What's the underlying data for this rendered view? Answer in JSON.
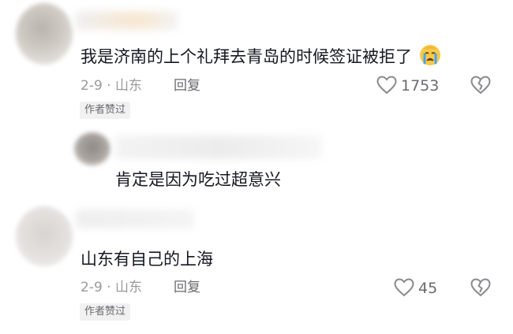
{
  "colors": {
    "text_primary": "#161823",
    "text_meta": "#9a9a9e",
    "badge_bg": "#f1f1f2",
    "icon_stroke": "#8a8a8f"
  },
  "comments": [
    {
      "text": "我是济南的上个礼拜去青岛的时候签证被拒了",
      "emoji": "crying-face-icon",
      "date_location": "2-9 · 山东",
      "reply_label": "回复",
      "likes": "1753",
      "badge": "作者赞过"
    },
    {
      "text": "山东有自己的上海",
      "date_location": "2-9 · 山东",
      "reply_label": "回复",
      "likes": "45",
      "badge": "作者赞过"
    }
  ],
  "reply": {
    "text": "肯定是因为吃过超意兴"
  }
}
